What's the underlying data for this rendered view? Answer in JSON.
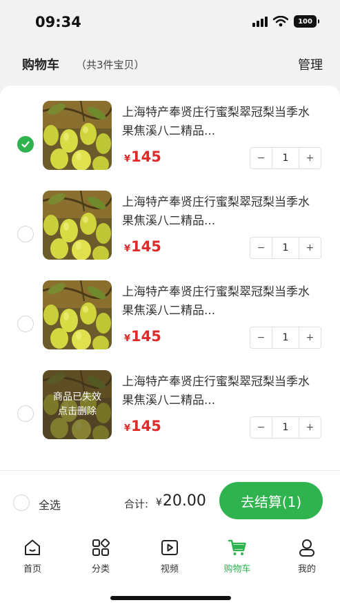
{
  "status_bar": {
    "time": "09:34",
    "battery": "100",
    "icons": [
      "signal-icon",
      "wifi-icon",
      "battery-icon"
    ]
  },
  "header": {
    "title": "购物车",
    "count": "（共3件宝贝）",
    "manage": "管理"
  },
  "items": [
    {
      "name_line1": "上海特产奉贤庄行蜜梨翠冠梨当季水",
      "name_line2": "果焦溪八二精品...",
      "currency": "¥",
      "price": "145",
      "qty": "1",
      "minus": "−",
      "plus": "+",
      "checked": true
    },
    {
      "name_line1": "上海特产奉贤庄行蜜梨翠冠梨当季水",
      "name_line2": "果焦溪八二精品...",
      "currency": "¥",
      "price": "145",
      "qty": "1",
      "minus": "−",
      "plus": "+",
      "checked": false
    },
    {
      "name_line1": "上海特产奉贤庄行蜜梨翠冠梨当季水",
      "name_line2": "果焦溪八二精品...",
      "currency": "¥",
      "price": "145",
      "qty": "1",
      "minus": "−",
      "plus": "+",
      "checked": false
    },
    {
      "name_line1": "上海特产奉贤庄行蜜梨翠冠梨当季水",
      "name_line2": "果焦溪八二精品...",
      "currency": "¥",
      "price": "145",
      "qty": "1",
      "minus": "−",
      "plus": "+",
      "checked": false,
      "invalid_line1": "商品已失效",
      "invalid_line2": "点击删除"
    }
  ],
  "checkout": {
    "select_all": "全选",
    "total_label": "合计:",
    "currency": "¥",
    "total": "20.00",
    "button": "去结算(1)"
  },
  "tabs": [
    {
      "label": "首页",
      "icon": "home-icon"
    },
    {
      "label": "分类",
      "icon": "category-icon"
    },
    {
      "label": "视频",
      "icon": "video-icon"
    },
    {
      "label": "购物车",
      "icon": "cart-icon",
      "active": true
    },
    {
      "label": "我的",
      "icon": "profile-icon"
    }
  ],
  "colors": {
    "accent": "#2eb34f",
    "price": "#e02a2a",
    "background": "#f2f2f2"
  }
}
